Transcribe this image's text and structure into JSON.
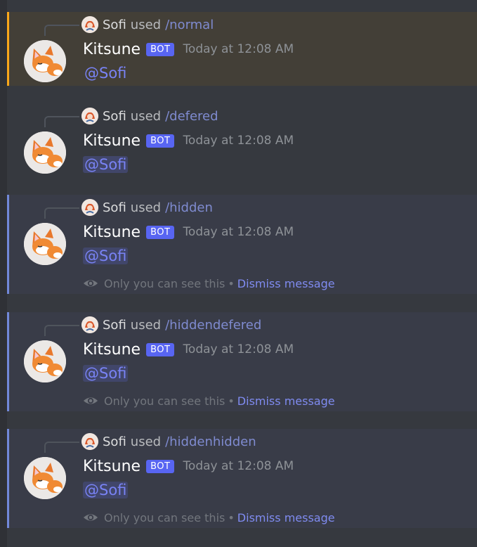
{
  "colors": {
    "background": "#36393f",
    "mention_highlight": "#433f37",
    "mention_bar": "#faa81a",
    "ephemeral_bg": "#393c48",
    "ephemeral_bar": "#7289da",
    "bot_tag": "#5865f2",
    "command": "#7f8bd0",
    "mention_text": "#7983f5",
    "dismiss_link": "#7f8bf0"
  },
  "messages": [
    {
      "reply_user": "Sofi",
      "reply_verb": "used",
      "command": "/normal",
      "author": "Kitsune",
      "bot_tag": "BOT",
      "timestamp": "Today at 12:08 AM",
      "mention": "@Sofi"
    },
    {
      "reply_user": "Sofi",
      "reply_verb": "used",
      "command": "/defered",
      "author": "Kitsune",
      "bot_tag": "BOT",
      "timestamp": "Today at 12:08 AM",
      "mention": "@Sofi"
    },
    {
      "reply_user": "Sofi",
      "reply_verb": "used",
      "command": "/hidden",
      "author": "Kitsune",
      "bot_tag": "BOT",
      "timestamp": "Today at 12:08 AM",
      "mention": "@Sofi",
      "ephemeral_text": "Only you can see this",
      "separator": "•",
      "dismiss": "Dismiss message"
    },
    {
      "reply_user": "Sofi",
      "reply_verb": "used",
      "command": "/hiddendefered",
      "author": "Kitsune",
      "bot_tag": "BOT",
      "timestamp": "Today at 12:08 AM",
      "mention": "@Sofi",
      "ephemeral_text": "Only you can see this",
      "separator": "•",
      "dismiss": "Dismiss message"
    },
    {
      "reply_user": "Sofi",
      "reply_verb": "used",
      "command": "/hiddenhidden",
      "author": "Kitsune",
      "bot_tag": "BOT",
      "timestamp": "Today at 12:08 AM",
      "mention": "@Sofi",
      "ephemeral_text": "Only you can see this",
      "separator": "•",
      "dismiss": "Dismiss message"
    }
  ]
}
